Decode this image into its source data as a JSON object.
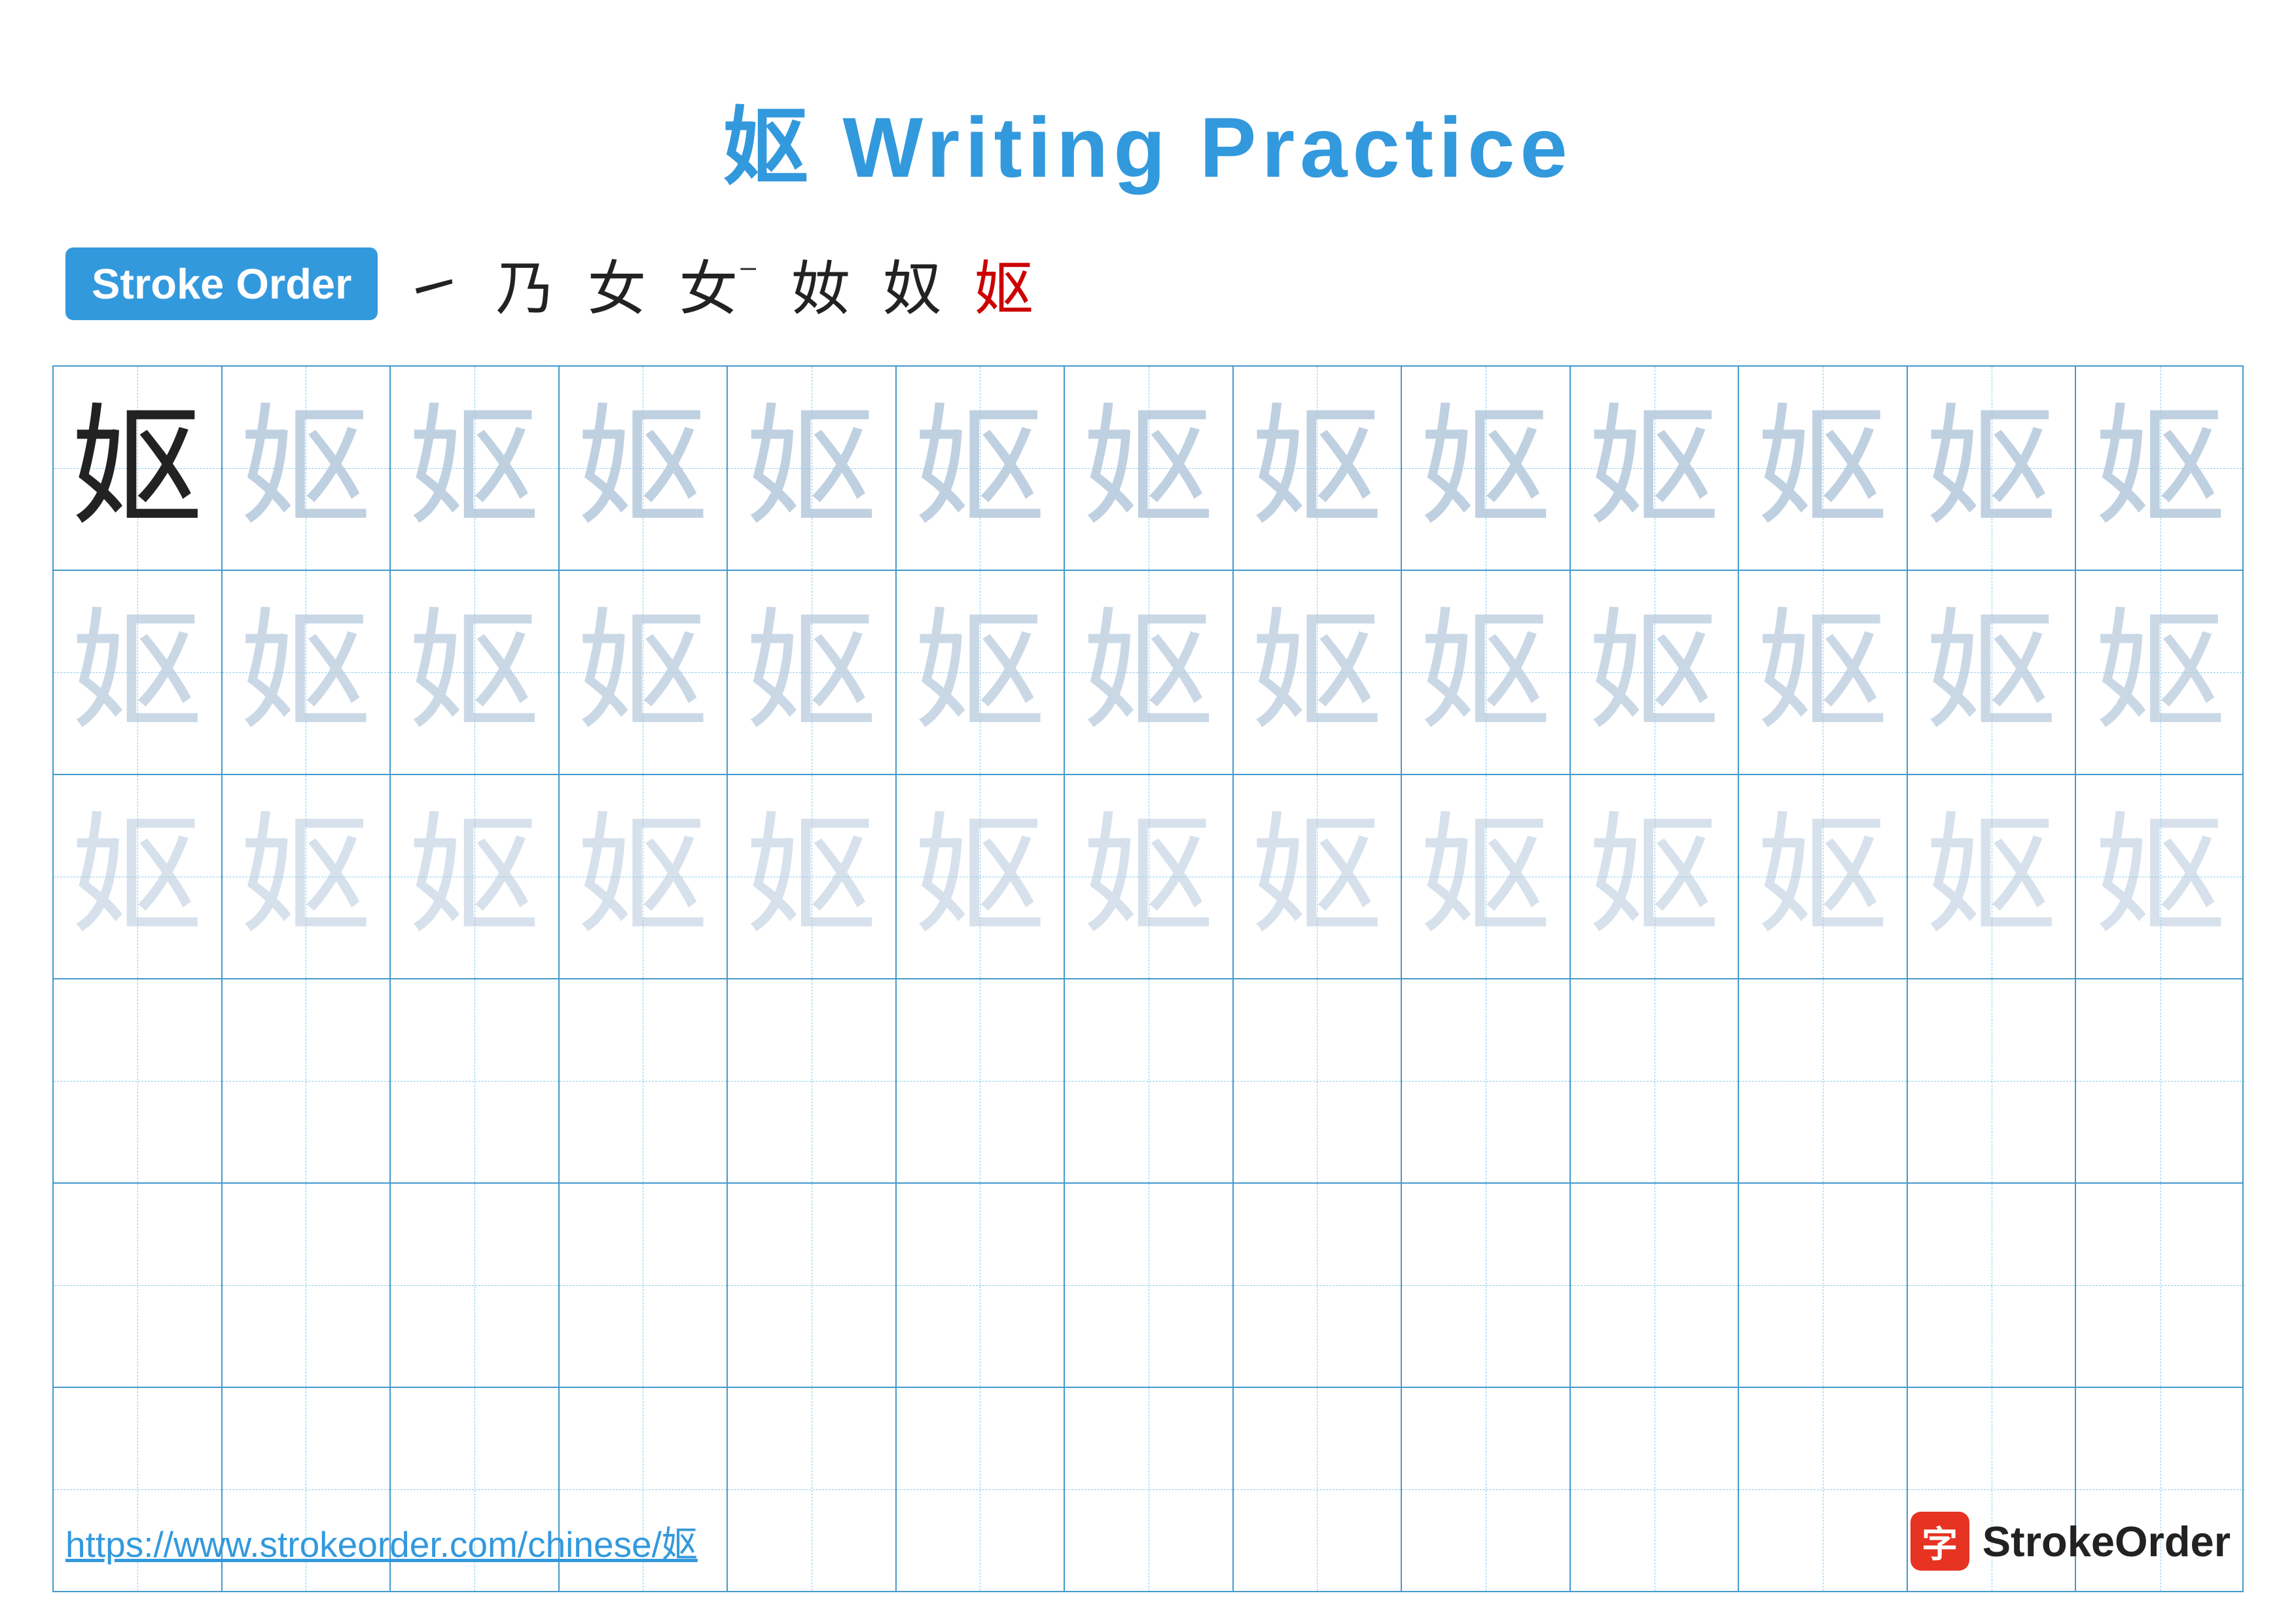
{
  "title": {
    "character": "妪",
    "text": "Writing Practice",
    "full": "妪 Writing Practice"
  },
  "stroke_order": {
    "badge": "Stroke Order",
    "steps": [
      "㇀",
      "乃",
      "女",
      "女¯",
      "奻",
      "奴",
      "妪"
    ]
  },
  "grid": {
    "rows": 6,
    "cols": 13,
    "character": "妪",
    "row_types": [
      "solid-then-faint1",
      "faint2",
      "faint3",
      "empty",
      "empty",
      "empty"
    ]
  },
  "footer": {
    "url": "https://www.strokeorder.com/chinese/妪",
    "logo_char": "字",
    "logo_text": "StrokeOrder"
  }
}
